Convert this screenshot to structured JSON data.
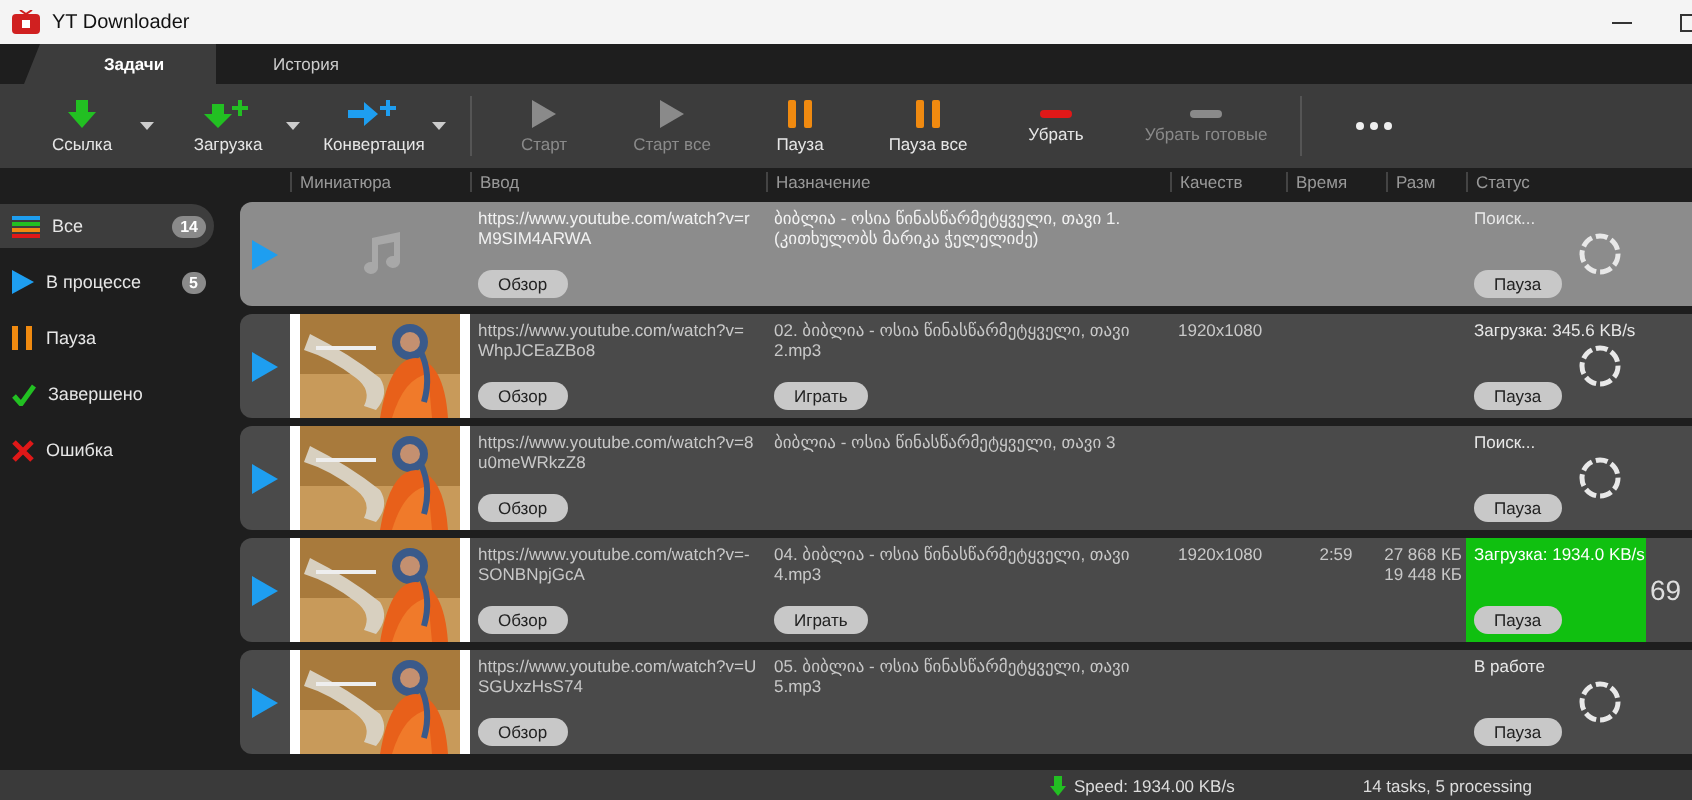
{
  "window": {
    "title": "YT Downloader"
  },
  "tabs": [
    {
      "label": "Задачи",
      "selected": true
    },
    {
      "label": "История",
      "selected": false
    }
  ],
  "toolbar": [
    {
      "label": "Ссылка",
      "kind": "link",
      "disabled": false
    },
    {
      "label": "Загрузка",
      "kind": "download",
      "disabled": false
    },
    {
      "label": "Конвертация",
      "kind": "convert",
      "disabled": false
    },
    {
      "label": "Старт",
      "kind": "start",
      "disabled": true
    },
    {
      "label": "Старт все",
      "kind": "start",
      "disabled": true
    },
    {
      "label": "Пауза",
      "kind": "pause",
      "disabled": false
    },
    {
      "label": "Пауза все",
      "kind": "pause",
      "disabled": false
    },
    {
      "label": "Убрать",
      "kind": "remove",
      "disabled": false
    },
    {
      "label": "Убрать готовые",
      "kind": "remove",
      "disabled": true
    },
    {
      "kind": "more",
      "disabled": false
    }
  ],
  "columns": [
    "Миниатюра",
    "Ввод",
    "Назначение",
    "Качеств",
    "Время",
    "Разм",
    "Статус"
  ],
  "sidebar": {
    "items": [
      {
        "label": "Все",
        "kind": "all",
        "count": "14",
        "selected": true
      },
      {
        "label": "В процессе",
        "kind": "processing",
        "count": "5",
        "selected": false
      },
      {
        "label": "Пауза",
        "kind": "paused",
        "selected": false
      },
      {
        "label": "Завершено",
        "kind": "done",
        "selected": false
      },
      {
        "label": "Ошибка",
        "kind": "error",
        "selected": false
      }
    ]
  },
  "tasks": [
    {
      "kind": "audio",
      "selected": true,
      "url": "https://www.youtube.com/watch?v=rM9SIM4ARWA",
      "input_button": "Обзор",
      "destination": "ბიბლია - ოსია წინასწარმეტყველი, თავი 1. (კითხულობს მარიკა ჭელელიძე)",
      "status": "Поиск...",
      "highlighted": false,
      "status_button": "Пауза"
    },
    {
      "kind": "video",
      "selected": false,
      "url": "https://www.youtube.com/watch?v=WhpJCEaZBo8",
      "input_button": "Обзор",
      "destination": "02. ბიბლია - ოსია წინასწარმეტყველი, თავი 2.mp3",
      "dest_button": "Играть",
      "quality": "1920x1080",
      "status": "Загрузка: 345.6 KB/s",
      "highlighted": false,
      "status_button": "Пауза"
    },
    {
      "kind": "video",
      "selected": false,
      "url": "https://www.youtube.com/watch?v=8u0meWRkzZ8",
      "input_button": "Обзор",
      "destination": "ბიბლია - ოსია წინასწარმეტყველი, თავი 3",
      "status": "Поиск...",
      "highlighted": false,
      "status_button": "Пауза"
    },
    {
      "kind": "video",
      "selected": false,
      "url": "https://www.youtube.com/watch?v=-SONBNpjGcA",
      "input_button": "Обзор",
      "destination": "04. ბიბლია - ოსია წინასწარმეტყველი, თავი 4.mp3",
      "dest_button": "Играть",
      "quality": "1920x1080",
      "time": "2:59",
      "size": [
        "27 868 КБ",
        "19 448 КБ"
      ],
      "status": "Загрузка: 1934.0 KB/s",
      "highlighted": true,
      "status_button": "Пауза",
      "percent": "69"
    },
    {
      "kind": "video",
      "selected": false,
      "url": "https://www.youtube.com/watch?v=USGUxzHsS74",
      "input_button": "Обзор",
      "destination": "05. ბიბლია - ოსია წინასწარმეტყველი, თავი 5.mp3",
      "status": "В работе",
      "highlighted": false,
      "status_button": "Пауза"
    }
  ],
  "status_bar": {
    "speed": "Speed: 1934.00 KB/s",
    "summary": "14 tasks, 5 processing"
  }
}
